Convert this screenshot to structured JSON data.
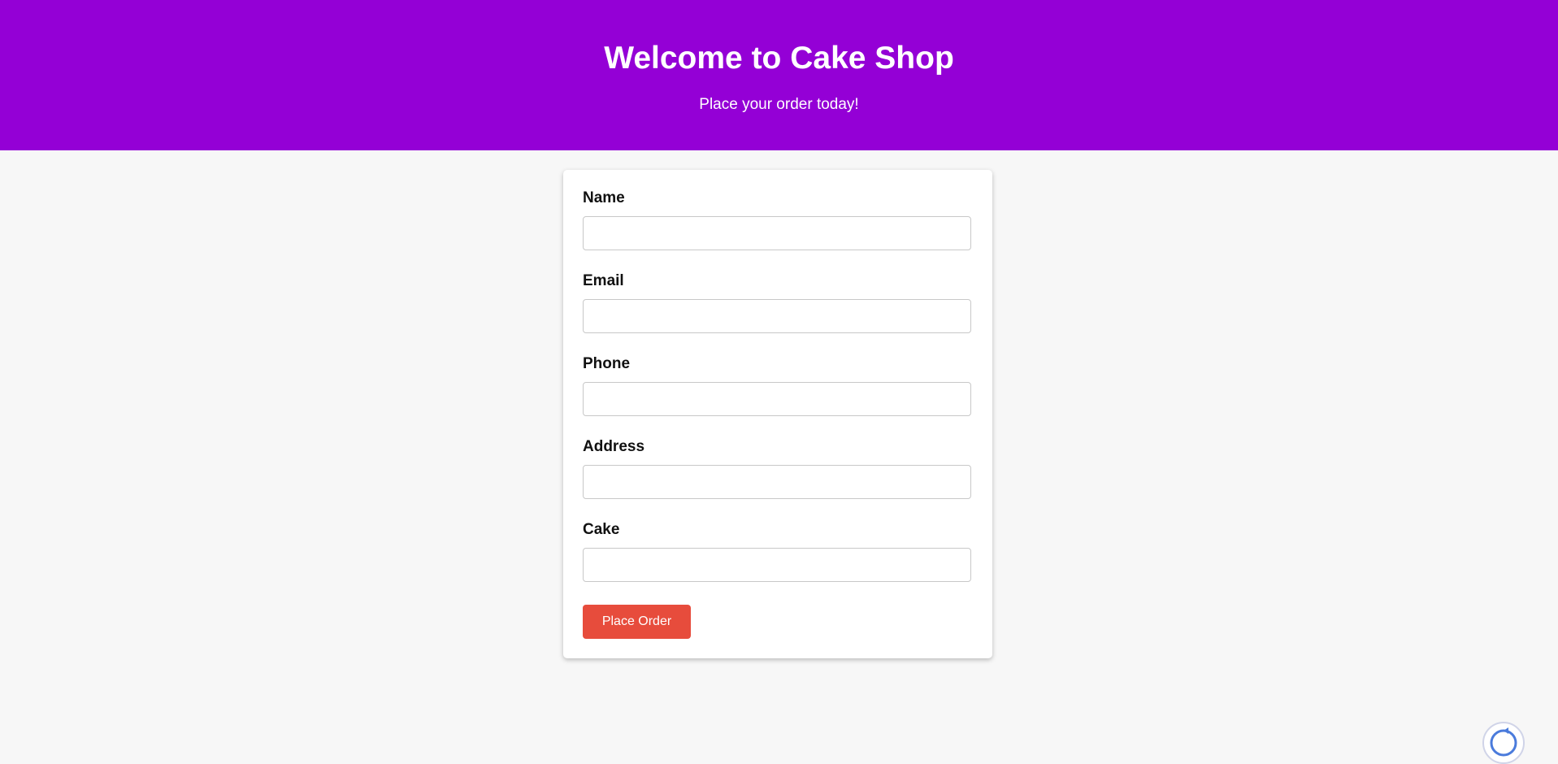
{
  "header": {
    "title": "Welcome to Cake Shop",
    "subtitle": "Place your order today!",
    "background_color": "#9400d6"
  },
  "form": {
    "fields": [
      {
        "label": "Name",
        "value": "",
        "placeholder": ""
      },
      {
        "label": "Email",
        "value": "",
        "placeholder": ""
      },
      {
        "label": "Phone",
        "value": "",
        "placeholder": ""
      },
      {
        "label": "Address",
        "value": "",
        "placeholder": ""
      },
      {
        "label": "Cake",
        "value": "",
        "placeholder": ""
      }
    ],
    "submit_label": "Place Order",
    "submit_color": "#e74c3c"
  },
  "widget": {
    "icon": "recaptcha-icon"
  }
}
